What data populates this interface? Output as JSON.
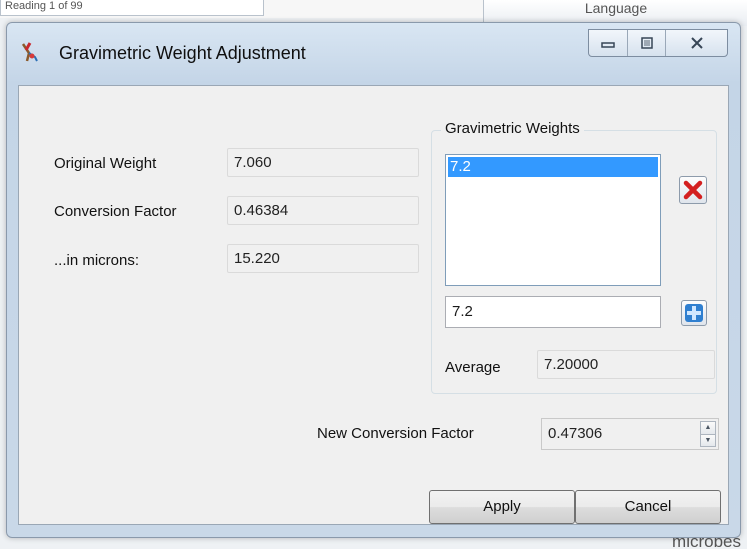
{
  "background": {
    "left_tab_text": "Reading 1 of 99",
    "right_tab_text": "Language",
    "bottom_right_text": "microbes"
  },
  "window": {
    "title": "Gravimetric Weight Adjustment",
    "caption_buttons": [
      "minimize",
      "restore",
      "close"
    ]
  },
  "fields": {
    "original_weight": {
      "label": "Original Weight",
      "value": "7.060"
    },
    "conversion_factor": {
      "label": "Conversion Factor",
      "value": "0.46384"
    },
    "in_microns": {
      "label": "...in microns:",
      "value": "15.220"
    }
  },
  "gravimetric_weights": {
    "group_title": "Gravimetric Weights",
    "items": [
      "7.2"
    ],
    "selected_index": 0,
    "remove_icon": "red-x-icon",
    "entry_value": "7.2",
    "add_icon": "blue-plus-icon",
    "average_label": "Average",
    "average_value": "7.20000"
  },
  "new_conversion_factor": {
    "label": "New Conversion Factor",
    "value": "0.47306"
  },
  "buttons": {
    "apply": "Apply",
    "cancel": "Cancel"
  },
  "colors": {
    "selection": "#3399ff",
    "remove": "#d32020",
    "add": "#2f7fd0"
  }
}
